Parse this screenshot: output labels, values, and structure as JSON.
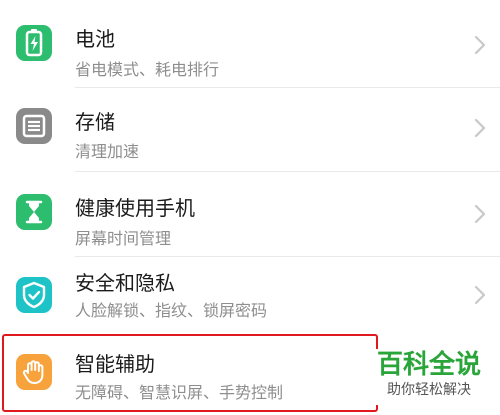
{
  "items": [
    {
      "title": "电池",
      "subtitle": "省电模式、耗电排行",
      "icon": "battery-icon",
      "color": "#2dbd6e"
    },
    {
      "title": "存储",
      "subtitle": "清理加速",
      "icon": "storage-icon",
      "color": "#8a8a8a"
    },
    {
      "title": "健康使用手机",
      "subtitle": "屏幕时间管理",
      "icon": "hourglass-icon",
      "color": "#2dbd6e"
    },
    {
      "title": "安全和隐私",
      "subtitle": "人脸解锁、指纹、锁屏密码",
      "icon": "shield-icon",
      "color": "#1ec3c8"
    },
    {
      "title": "智能辅助",
      "subtitle": "无障碍、智慧识屏、手势控制",
      "icon": "hand-icon",
      "color": "#f7a23a"
    }
  ],
  "highlight_color": "#e0191e",
  "watermark": {
    "title": "百科全说",
    "subtitle": "助你轻松解决",
    "color": "#2aa53a"
  }
}
